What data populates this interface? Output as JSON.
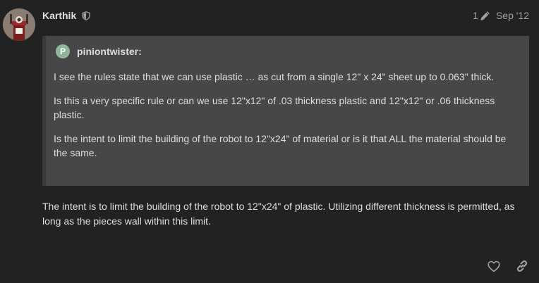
{
  "post": {
    "author": "Karthik",
    "edit_count": "1",
    "date": "Sep '12",
    "quote": {
      "avatar_letter": "P",
      "username": "piniontwister:",
      "paragraphs": [
        "I see the rules state that we can use plastic … as cut from a single 12\" x 24\" sheet up to 0.063\" thick.",
        "Is this a very specific rule or can we use 12\"x12\" of .03 thickness plastic and 12\"x12\" or .06 thickness plastic.",
        "Is the intent to limit the building of the robot to 12\"x24\" of material or is it that ALL the material should be the same."
      ]
    },
    "reply": "The intent is to limit the building of the robot to 12\"x24\" of plastic. Utilizing different thickness is permitted, as long as the pieces wall within this limit."
  },
  "icons": {
    "moderator": "shield-icon",
    "edit": "pencil-icon",
    "like": "heart-icon",
    "share": "link-icon"
  },
  "colors": {
    "background": "#222222",
    "quote_background": "#474747",
    "text": "#dddddd",
    "muted": "#a0a0a0",
    "quote_avatar": "#8fb69a"
  }
}
